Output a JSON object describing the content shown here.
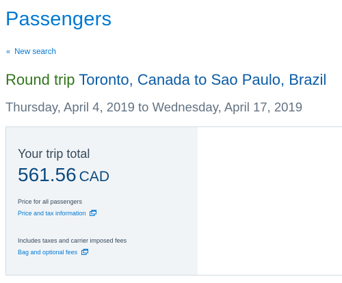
{
  "page": {
    "title": "Passengers"
  },
  "nav": {
    "back_chevron": "«",
    "back_label": "New search"
  },
  "trip": {
    "type": "Round trip",
    "route": "Toronto, Canada to Sao Paulo, Brazil",
    "dates": "Thursday, April 4, 2019 to Wednesday, April 17, 2019"
  },
  "summary": {
    "total_label": "Your trip total",
    "amount": "561.56",
    "currency": "CAD",
    "price_note": "Price for all passengers",
    "price_link": "Price and tax information",
    "fees_note": "Includes taxes and carrier imposed fees",
    "bag_link": "Bag and optional fees",
    "link_icon": "external-window-icon"
  },
  "colors": {
    "title_blue": "#0078d2",
    "trip_type_green": "#32751c",
    "route_blue": "#0b5ca5",
    "panel_background": "#f1f4f7"
  }
}
